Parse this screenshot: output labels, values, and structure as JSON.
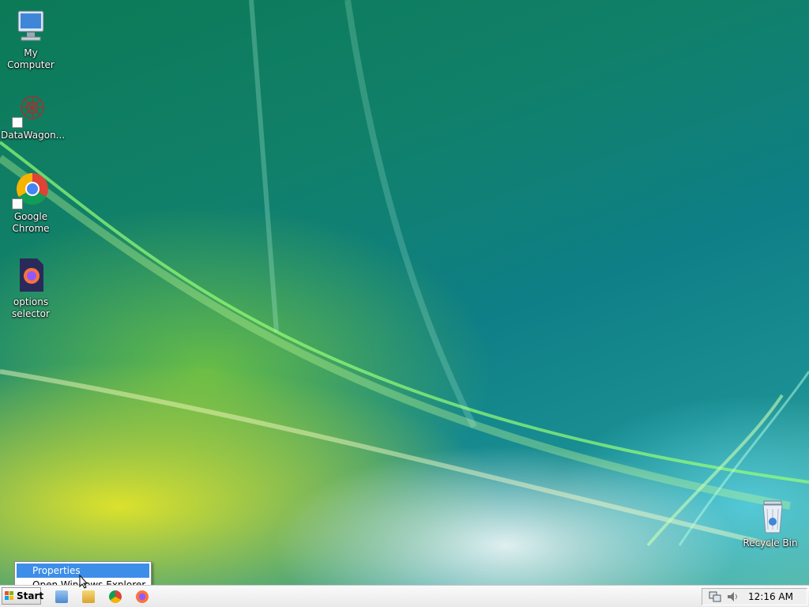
{
  "desktop": {
    "icons": [
      {
        "label": "My Computer",
        "icon": "my-computer-icon"
      },
      {
        "label": "DataWagon...",
        "icon": "datawagon-icon",
        "shortcut": true
      },
      {
        "label": "Google Chrome",
        "icon": "chrome-icon",
        "shortcut": true
      },
      {
        "label": "options selector",
        "icon": "firefox-file-icon"
      },
      {
        "label": "Recycle Bin",
        "icon": "recycle-bin-icon"
      }
    ]
  },
  "context_menu": {
    "items": [
      {
        "label": "Properties",
        "selected": true
      },
      {
        "label": "Open Windows Explorer",
        "selected": false
      }
    ]
  },
  "taskbar": {
    "start_label": "Start",
    "quick_launch": [
      "show-desktop-icon",
      "explorer-icon",
      "chrome-icon",
      "firefox-icon"
    ],
    "clock": "12:16 AM"
  },
  "colors": {
    "selection": "#3d8ee8",
    "taskbar": "#eeeeee"
  }
}
